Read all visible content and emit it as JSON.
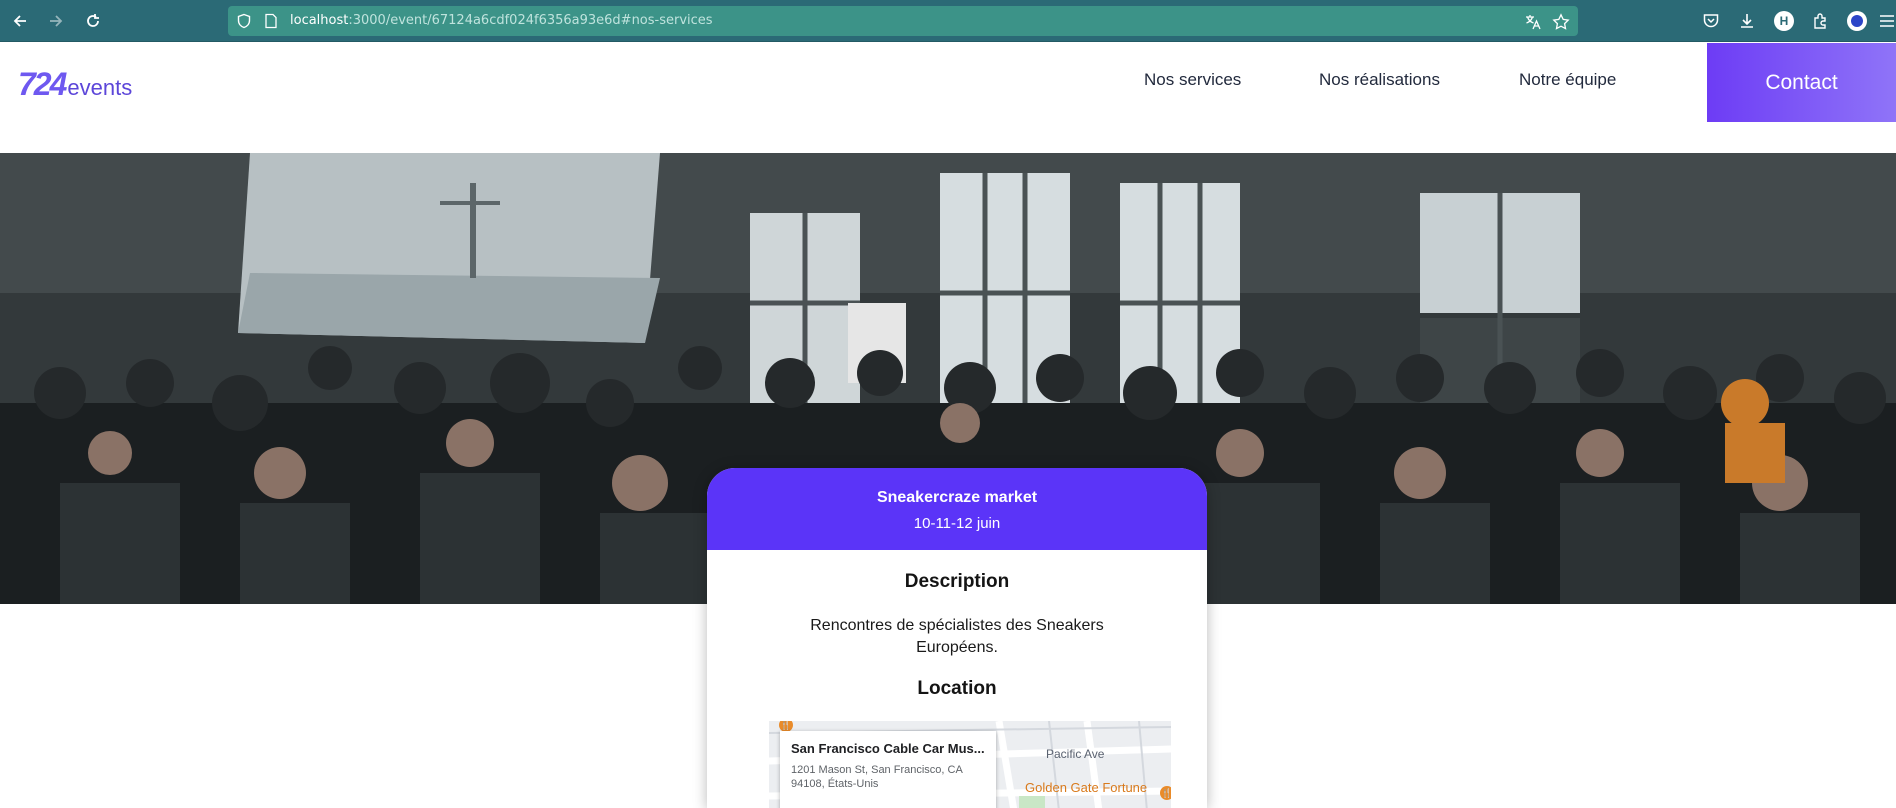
{
  "browser": {
    "url_host": "localhost",
    "url_path": ":3000/event/67124a6cdf024f6356a93e6d#nos-services",
    "profile_initial": "H",
    "theme_colors": {
      "toolbar": "#2b6a76",
      "url_bar": "#3c9388"
    }
  },
  "header": {
    "logo_number": "724",
    "logo_word": "events",
    "nav": {
      "services": "Nos services",
      "realisations": "Nos réalisations",
      "equipe": "Notre équipe"
    },
    "contact_label": "Contact",
    "accent_color": "#5b34f8"
  },
  "event": {
    "title": "Sneakercraze market",
    "dates": "10-11-12 juin",
    "description_heading": "Description",
    "description": "Rencontres de spécialistes des Sneakers Européens.",
    "location_heading": "Location"
  },
  "map": {
    "place_name": "San Francisco Cable Car Mus...",
    "address": "1201 Mason St, San Francisco, CA 94108, États-Unis",
    "street_label": "Pacific Ave",
    "poi_label": "Golden Gate Fortune"
  },
  "icons": [
    "back-icon",
    "forward-icon",
    "reload-icon",
    "shield-icon",
    "page-icon",
    "translate-icon",
    "star-icon",
    "pocket-icon",
    "download-icon",
    "extensions-icon",
    "menu-icon"
  ]
}
